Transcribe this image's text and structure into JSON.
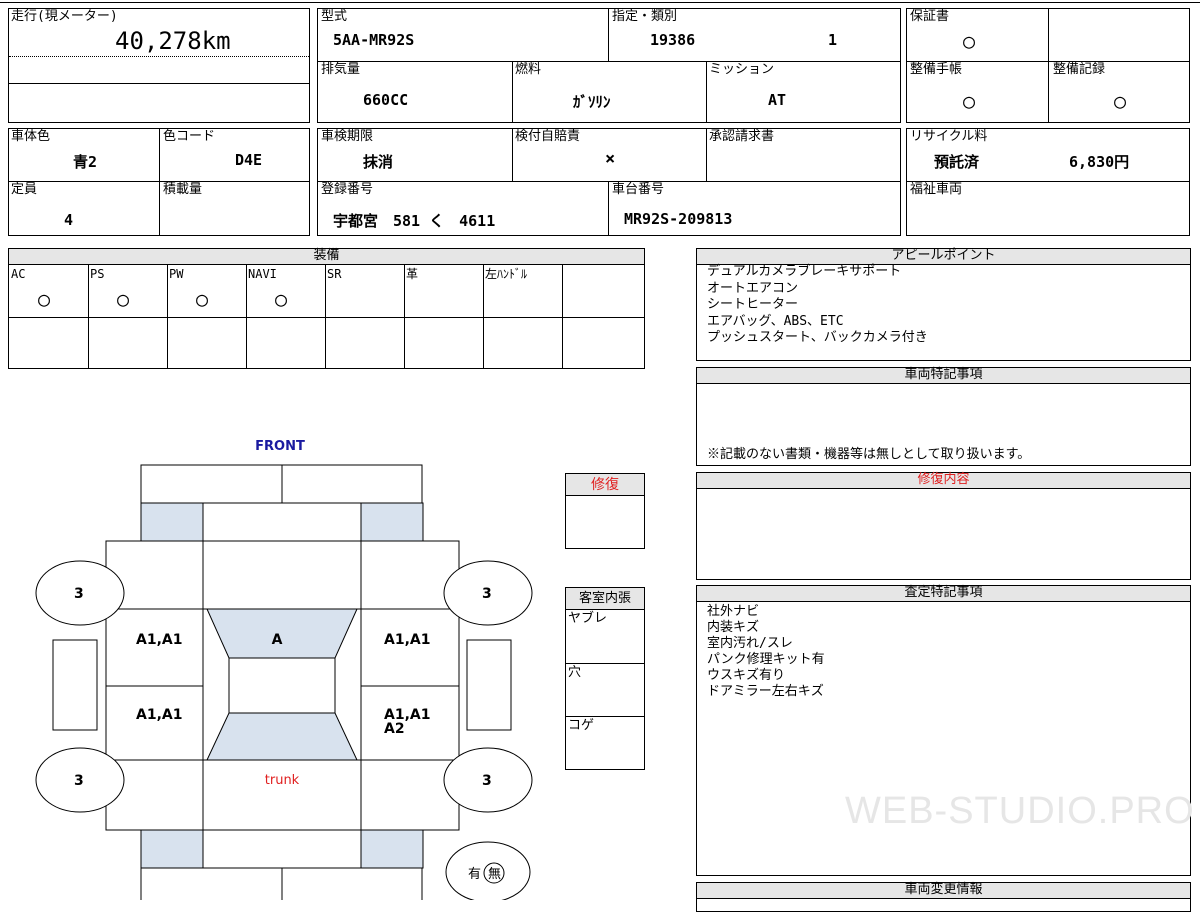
{
  "mileage": {
    "label": "走行(現メーター)",
    "value": "40,278km"
  },
  "model": {
    "label": "型式",
    "value": "5AA-MR92S"
  },
  "designation": {
    "label": "指定・類別",
    "value1": "19386",
    "value2": "1"
  },
  "warranty": {
    "label": "保証書",
    "value": "○"
  },
  "displacement": {
    "label": "排気量",
    "value": "660CC"
  },
  "fuel": {
    "label": "燃料",
    "value": "ｶﾞｿﾘﾝ"
  },
  "transmission": {
    "label": "ミッション",
    "value": "AT"
  },
  "maintenance_book": {
    "label": "整備手帳",
    "value": "○"
  },
  "maintenance_record": {
    "label": "整備記録",
    "value": "○"
  },
  "body_color": {
    "label": "車体色",
    "value": "青2"
  },
  "color_code": {
    "label": "色コード",
    "value": "D4E"
  },
  "inspection_expiry": {
    "label": "車検期限",
    "value": "抹消"
  },
  "insurance": {
    "label": "検付自賠責",
    "value": "×"
  },
  "approval_request": {
    "label": "承認請求書",
    "value": ""
  },
  "recycle_fee": {
    "label": "リサイクル料",
    "value1": "預託済",
    "value2": "6,830円"
  },
  "capacity": {
    "label": "定員",
    "value": "4"
  },
  "load": {
    "label": "積載量",
    "value": ""
  },
  "registration": {
    "label": "登録番号",
    "value": "宇都宮　581 く　4611"
  },
  "chassis": {
    "label": "車台番号",
    "value": "MR92S-209813"
  },
  "welfare": {
    "label": "福祉車両",
    "value": ""
  },
  "equipment": {
    "title": "装備",
    "items": [
      {
        "label": "AC",
        "value": "○"
      },
      {
        "label": "PS",
        "value": "○"
      },
      {
        "label": "PW",
        "value": "○"
      },
      {
        "label": "NAVI",
        "value": "○"
      },
      {
        "label": "SR",
        "value": ""
      },
      {
        "label": "革",
        "value": ""
      },
      {
        "label": "左ﾊﾝﾄﾞﾙ",
        "value": ""
      },
      {
        "label": "",
        "value": ""
      }
    ]
  },
  "appeal": {
    "title": "アピールポイント",
    "text": "デュアルカメラブレーキサポート\nオートエアコン\nシートヒーター\nエアバッグ、ABS、ETC\nプッシュスタート、バックカメラ付き"
  },
  "vehicle_notes": {
    "title": "車両特記事項",
    "footer": "※記載のない書類・機器等は無しとして取り扱います。"
  },
  "repair": {
    "title": "修復"
  },
  "repair_details": {
    "title": "修復内容"
  },
  "interior": {
    "title": "客室内張",
    "rows": [
      "ヤブレ",
      "穴",
      "コゲ"
    ]
  },
  "assessment": {
    "title": "査定特記事項",
    "text": "社外ナビ\n内装キズ\n室内汚れ/スレ\nパンク修理キット有\nウスキズ有り\nドアミラー左右キズ"
  },
  "change_info": {
    "title": "車両変更情報"
  },
  "diagram": {
    "front": "FRONT",
    "trunk": "trunk",
    "tires": [
      "3",
      "3",
      "3",
      "3"
    ],
    "roof": "A",
    "front_left_door": "A1,A1",
    "front_right_door": "A1,A1",
    "rear_left_door": "A1,A1",
    "rear_right_door": [
      "A1,A1",
      "A2"
    ],
    "spare": {
      "yes": "有",
      "no": "無"
    }
  },
  "watermark": "WEB-STUDIO.PRO"
}
